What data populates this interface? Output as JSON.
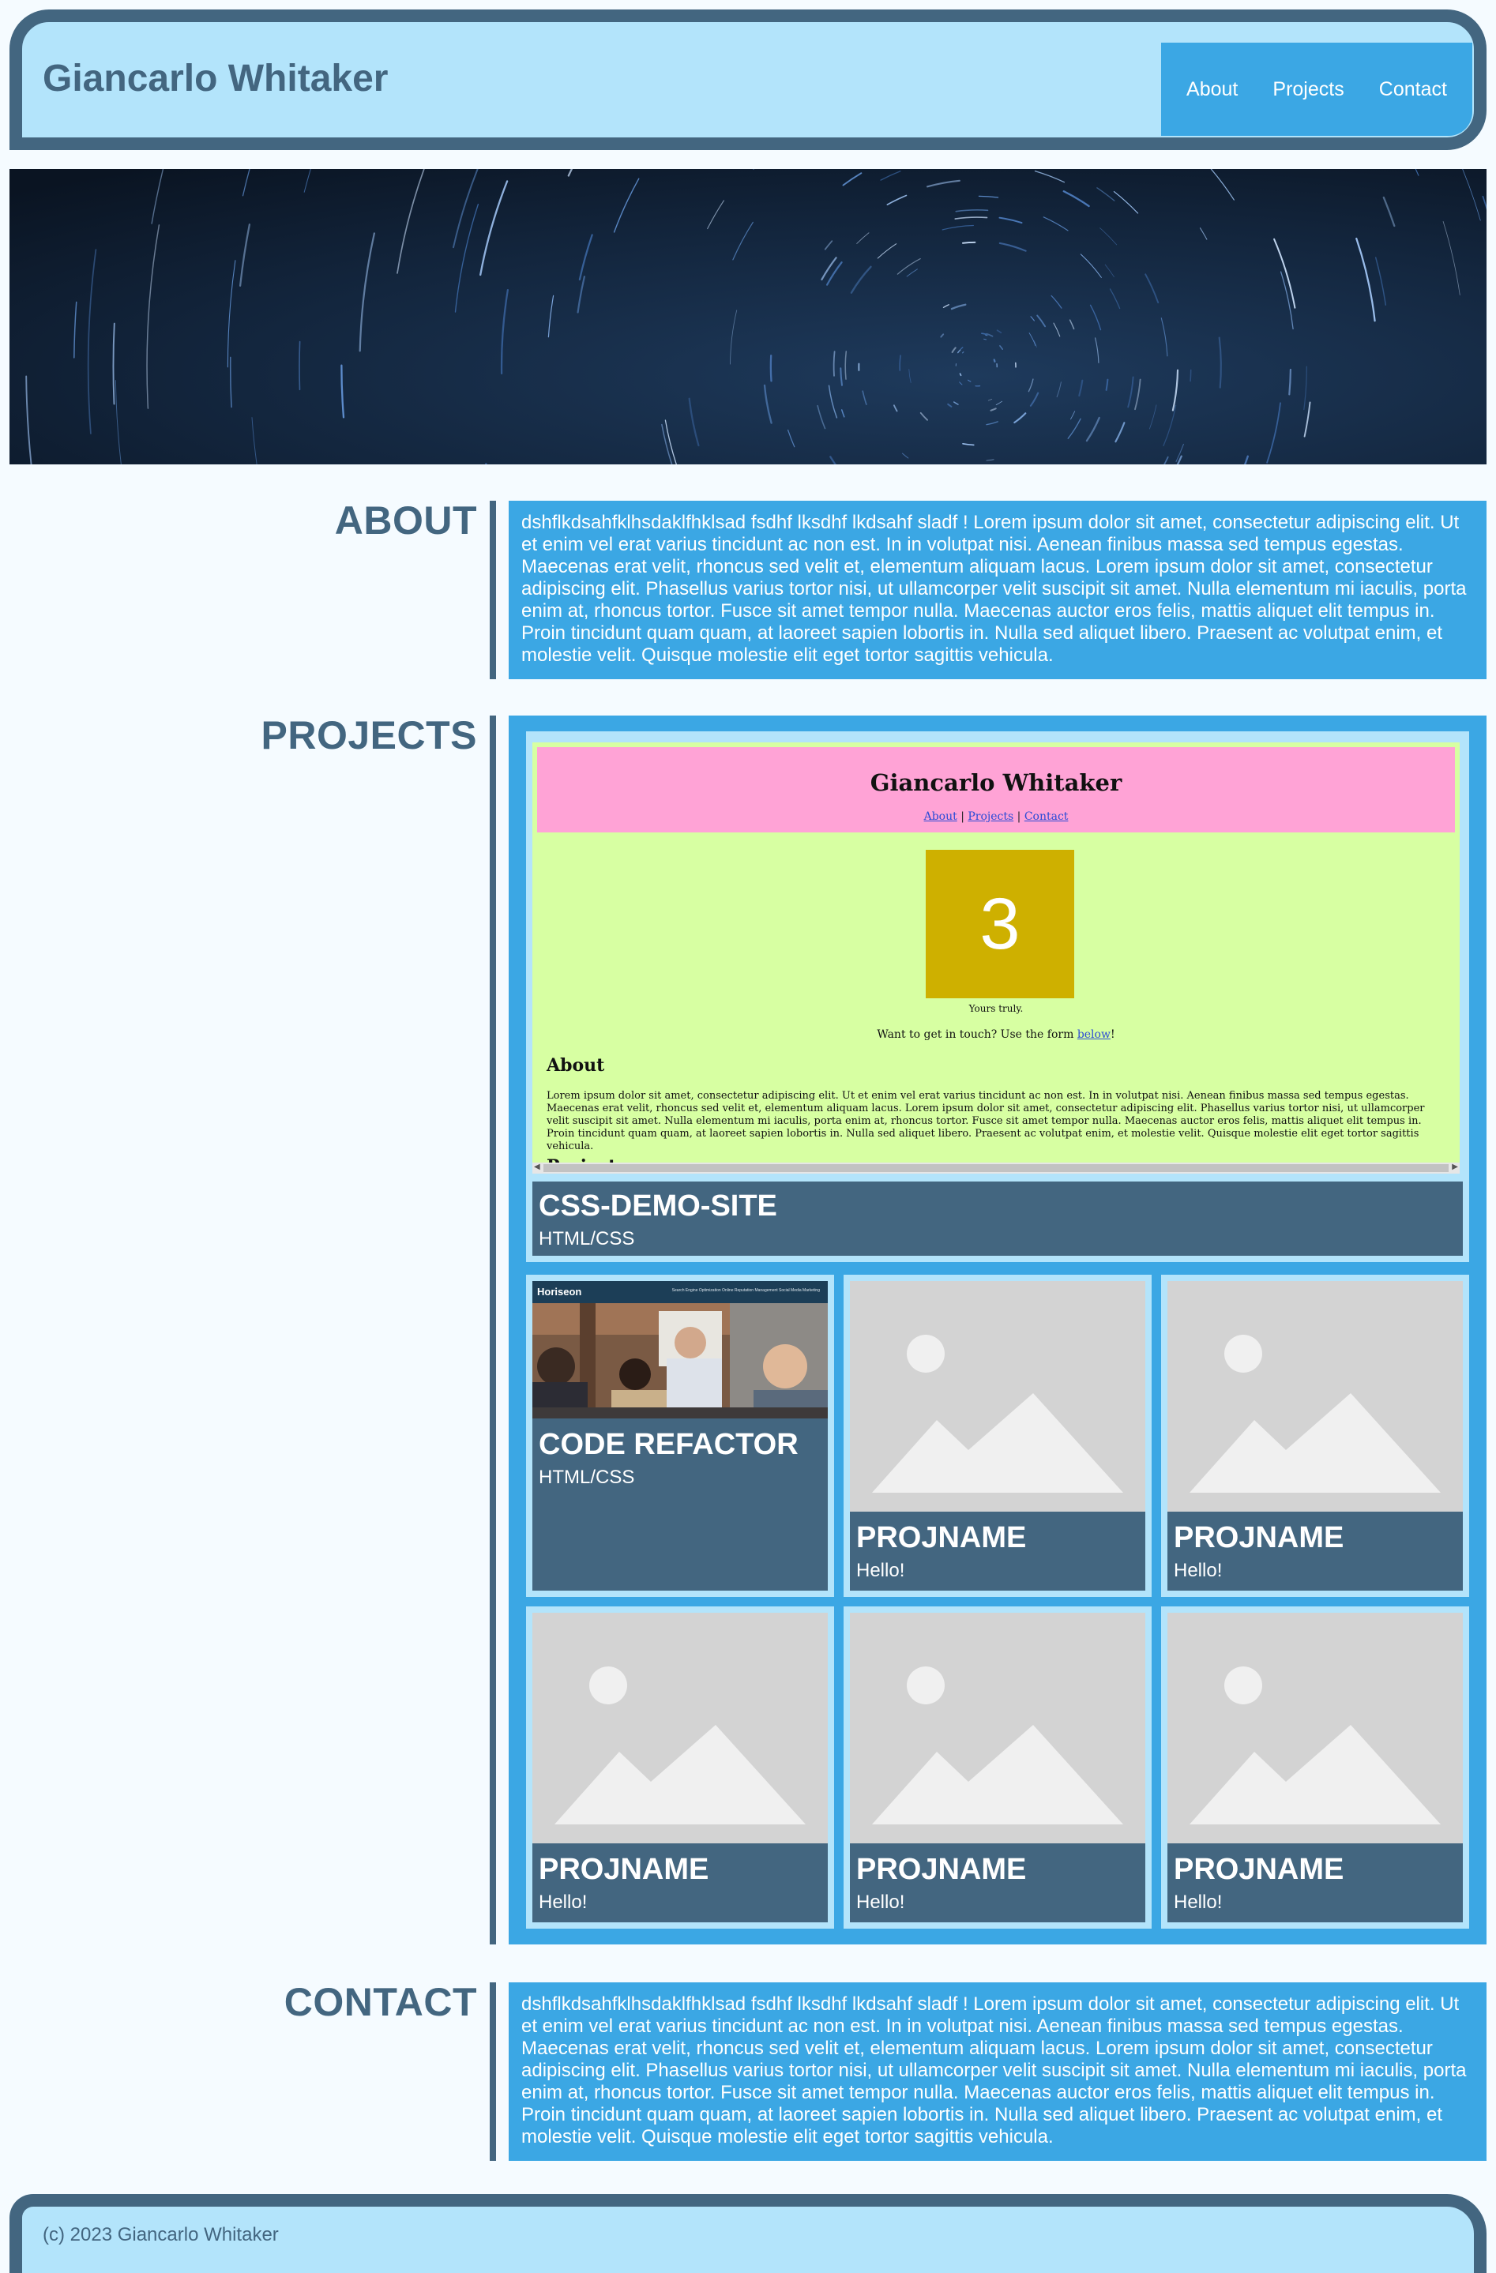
{
  "header": {
    "title": "Giancarlo Whitaker",
    "nav": [
      "About",
      "Projects",
      "Contact"
    ]
  },
  "about": {
    "heading": "ABOUT",
    "text": "dshflkdsahfklhsdaklfhklsad fsdhf lksdhf lkdsahf sladf ! Lorem ipsum dolor sit amet, consectetur adipiscing elit. Ut et enim vel erat varius tincidunt ac non est. In in volutpat nisi. Aenean finibus massa sed tempus egestas. Maecenas erat velit, rhoncus sed velit et, elementum aliquam lacus. Lorem ipsum dolor sit amet, consectetur adipiscing elit. Phasellus varius tortor nisi, ut ullamcorper velit suscipit sit amet. Nulla elementum mi iaculis, porta enim at, rhoncus tortor. Fusce sit amet tempor nulla. Maecenas auctor eros felis, mattis aliquet elit tempus in. Proin tincidunt quam quam, at laoreet sapien lobortis in. Nulla sed aliquet libero. Praesent ac volutpat enim, et molestie velit. Quisque molestie elit eget tortor sagittis vehicula."
  },
  "projects": {
    "heading": "PROJECTS",
    "featured": {
      "name": "CSS-DEMO-SITE",
      "tech": "HTML/CSS",
      "preview": {
        "title": "Giancarlo Whitaker",
        "nav": [
          "About",
          "Projects",
          "Contact"
        ],
        "nav_sep": "|",
        "box_number": "3",
        "caption": "Yours truly.",
        "touch_prefix": "Want to get in touch? Use the form ",
        "touch_link": "below",
        "touch_suffix": "!",
        "about_heading": "About",
        "about_body": "Lorem ipsum dolor sit amet, consectetur adipiscing elit. Ut et enim vel erat varius tincidunt ac non est. In in volutpat nisi. Aenean finibus massa sed tempus egestas. Maecenas erat velit, rhoncus sed velit et, elementum aliquam lacus. Lorem ipsum dolor sit amet, consectetur adipiscing elit. Phasellus varius tortor nisi, ut ullamcorper velit suscipit sit amet. Nulla elementum mi iaculis, porta enim at, rhoncus tortor. Fusce sit amet tempor nulla. Maecenas auctor eros felis, mattis aliquet elit tempus in. Proin tincidunt quam quam, at laoreet sapien lobortis in. Nulla sed aliquet libero. Praesent ac volutpat enim, et molestie velit. Quisque molestie elit eget tortor sagittis vehicula.",
        "projects_heading": "Projects"
      }
    },
    "items": [
      {
        "name": "CODE REFACTOR",
        "tech": "HTML/CSS",
        "preview": {
          "brand": "Horiseon",
          "nav": "Search Engine Optimization    Online Reputation Management    Social Media Marketing"
        }
      },
      {
        "name": "PROJNAME",
        "tech": "Hello!"
      },
      {
        "name": "PROJNAME",
        "tech": "Hello!"
      },
      {
        "name": "PROJNAME",
        "tech": "Hello!"
      },
      {
        "name": "PROJNAME",
        "tech": "Hello!"
      },
      {
        "name": "PROJNAME",
        "tech": "Hello!"
      }
    ]
  },
  "contact": {
    "heading": "CONTACT",
    "text": "dshflkdsahfklhsdaklfhklsad fsdhf lksdhf lkdsahf sladf ! Lorem ipsum dolor sit amet, consectetur adipiscing elit. Ut et enim vel erat varius tincidunt ac non est. In in volutpat nisi. Aenean finibus massa sed tempus egestas. Maecenas erat velit, rhoncus sed velit et, elementum aliquam lacus. Lorem ipsum dolor sit amet, consectetur adipiscing elit. Phasellus varius tortor nisi, ut ullamcorper velit suscipit sit amet. Nulla elementum mi iaculis, porta enim at, rhoncus tortor. Fusce sit amet tempor nulla. Maecenas auctor eros felis, mattis aliquet elit tempus in. Proin tincidunt quam quam, at laoreet sapien lobortis in. Nulla sed aliquet libero. Praesent ac volutpat enim, et molestie velit. Quisque molestie elit eget tortor sagittis vehicula."
  },
  "footer": {
    "text": "(c) 2023 Giancarlo Whitaker"
  },
  "colors": {
    "primary": "#436680",
    "accent": "#3ba7e4",
    "light": "#b3e4fb",
    "background": "#f5fbff"
  },
  "icons": {
    "hero": "star-trails-image",
    "placeholder": "image-placeholder-icon"
  }
}
